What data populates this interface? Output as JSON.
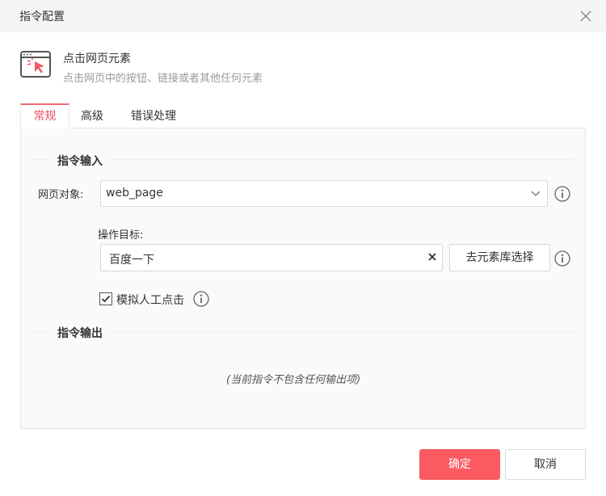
{
  "dialog": {
    "title": "指令配置"
  },
  "command": {
    "icon": "click-web-element-icon",
    "name": "点击网页元素",
    "description": "点击网页中的按钮、链接或者其他任何元素"
  },
  "tabs": [
    {
      "label": "常规",
      "active": true
    },
    {
      "label": "高级",
      "active": false
    },
    {
      "label": "错误处理",
      "active": false
    }
  ],
  "input_section": {
    "title": "指令输入",
    "web_object": {
      "label": "网页对象:",
      "value": "web_page"
    },
    "target": {
      "label": "操作目标:",
      "value": "百度一下",
      "picker_button": "去元素库选择"
    },
    "simulate_click": {
      "label": "模拟人工点击",
      "checked": true
    }
  },
  "output_section": {
    "title": "指令输出",
    "empty_text": "(当前指令不包含任何输出项)"
  },
  "footer": {
    "confirm": "确定",
    "cancel": "取消"
  },
  "colors": {
    "accent": "#fb5a63",
    "tab_active": "#e84f5b"
  }
}
